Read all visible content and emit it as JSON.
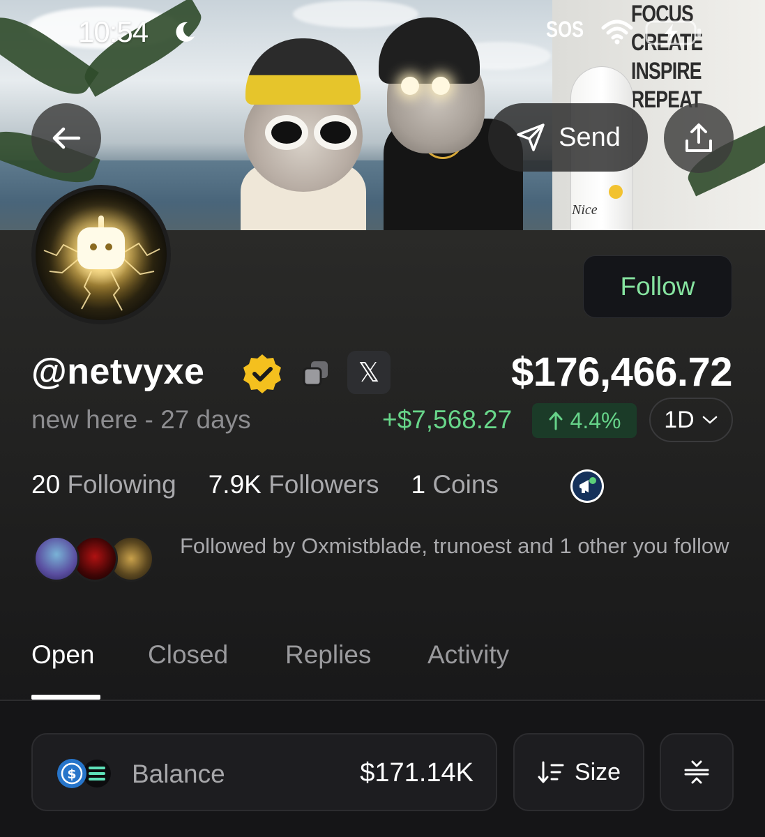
{
  "status_bar": {
    "time": "10:54",
    "carrier_status": "SOS"
  },
  "banner": {
    "wall_text": "FOCUS\nCREATE\nINSPIRE\nREPEAT",
    "surfboard_text": "Nice"
  },
  "header": {
    "send_label": "Send"
  },
  "profile": {
    "username": "@netvyxe",
    "subtitle": "new here - 27 days",
    "follow_label": "Follow",
    "x_label": "𝕏",
    "portfolio_value": "$176,466.72",
    "pnl": "+$7,568.27",
    "pnl_pct": "4.4%",
    "period": "1D",
    "accent_green": "#68d68a",
    "verified_color": "#f4c01e"
  },
  "stats": {
    "following_count": "20",
    "following_label": "Following",
    "followers_count": "7.9K",
    "followers_label": "Followers",
    "coins_count": "1",
    "coins_label": "Coins"
  },
  "followed_by": "Followed by Oxmistblade, trunoest and 1 other you follow",
  "tabs": [
    {
      "label": "Open",
      "active": true
    },
    {
      "label": "Closed",
      "active": false
    },
    {
      "label": "Replies",
      "active": false
    },
    {
      "label": "Activity",
      "active": false
    }
  ],
  "balance_card": {
    "label": "Balance",
    "value": "$171.14K"
  },
  "sort": {
    "label": "Size"
  }
}
